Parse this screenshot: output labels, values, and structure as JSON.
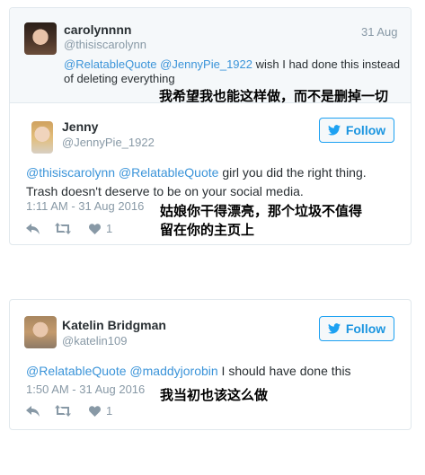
{
  "tweet1": {
    "reply_parent": {
      "name": "carolynnnn",
      "handle": "@thisiscarolynn",
      "date": "31 Aug",
      "mention1": "@RelatableQuote",
      "mention2": "@JennyPie_1922",
      "text_line1_rest": " wish I had done this instead",
      "text_line2": "of deleting everything",
      "translation": "我希望我也能这样做，而不是删掉一切"
    },
    "name": "Jenny",
    "handle": "@JennyPie_1922",
    "follow_label": "Follow",
    "mention1": "@thisiscarolynn",
    "mention2": "@RelatableQuote",
    "text_line1_rest": " girl you did the right thing.",
    "text_line2": "Trash doesn't deserve to be on your social media.",
    "timestamp": "1:11 AM - 31 Aug 2016",
    "translation_line1": "姑娘你干得漂亮，那个垃圾不值得",
    "translation_line2": "留在你的主页上",
    "like_count": "1"
  },
  "tweet2": {
    "name": "Katelin Bridgman",
    "handle": "@katelin109",
    "follow_label": "Follow",
    "mention1": "@RelatableQuote",
    "mention2": "@maddyjorobin",
    "text_rest": " I should have done this",
    "timestamp": "1:50 AM - 31 Aug 2016",
    "translation": "我当初也该这么做",
    "like_count": "1"
  },
  "colors": {
    "twitter_blue": "#1da1f2",
    "link_blue": "#3b94d9",
    "secondary_gray": "#8899a6",
    "text_dark": "#292f33"
  },
  "icons": [
    "twitter-bird-icon",
    "reply-icon",
    "retweet-icon",
    "heart-icon"
  ]
}
